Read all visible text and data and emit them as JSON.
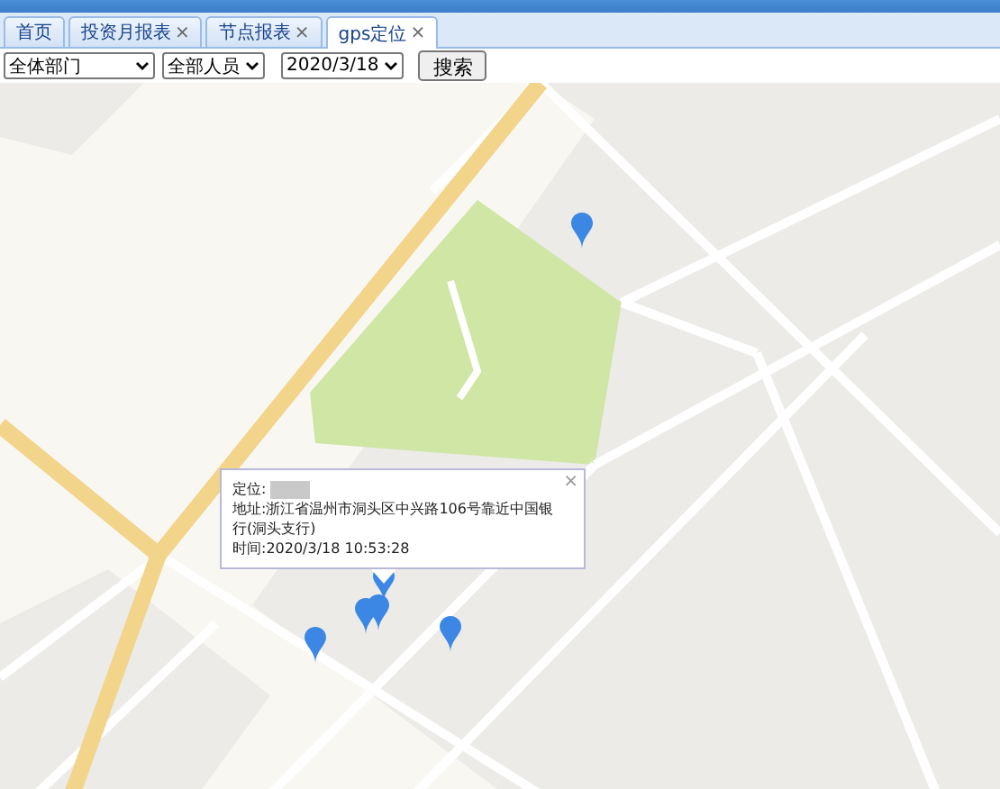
{
  "tabs": [
    {
      "label": "首页",
      "selected": false
    },
    {
      "label": "投资月报表",
      "close": "×",
      "selected": false
    },
    {
      "label": "节点报表",
      "close": "×",
      "selected": false
    },
    {
      "label": "gps定位",
      "close": "×",
      "selected": true
    }
  ],
  "filters": {
    "department": "全体部门",
    "staff": "全部人员",
    "date": "2020/3/18",
    "search_button": "搜索"
  },
  "popup": {
    "close": "×",
    "lines": [
      {
        "kind": "masked",
        "label": "定位:"
      },
      {
        "kind": "text",
        "label": "地址:浙江省温州市洞头区中兴路106号靠近中国银行(洞头支行)"
      },
      {
        "kind": "text",
        "label": "时间:2020/3/18 10:53:28"
      }
    ]
  }
}
